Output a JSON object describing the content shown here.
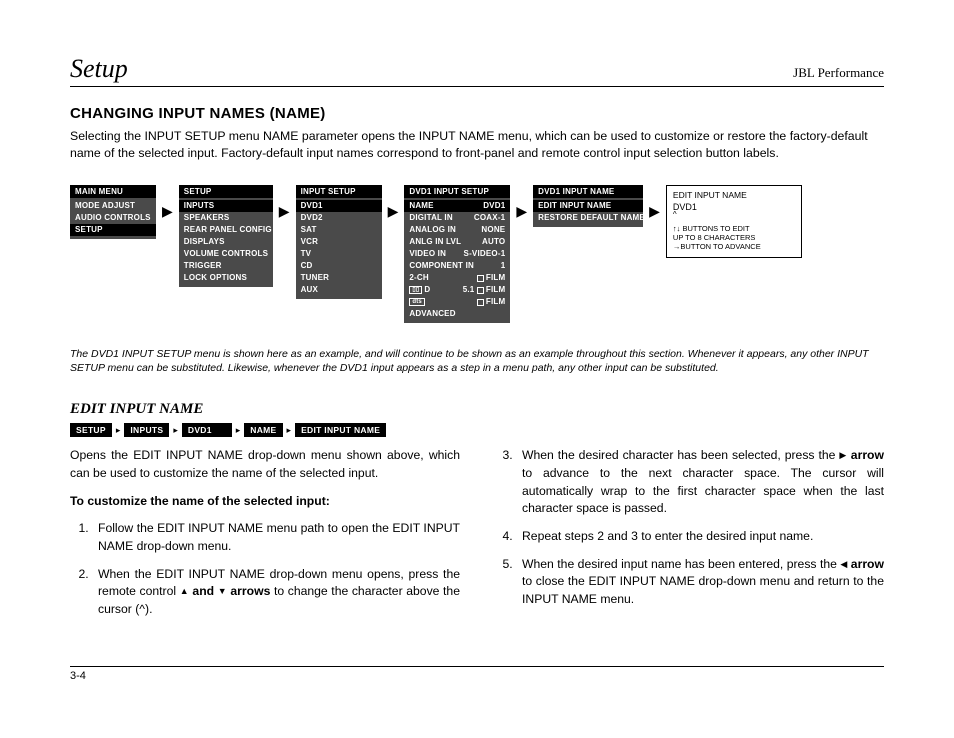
{
  "header": {
    "left": "Setup",
    "right": "JBL Performance"
  },
  "title": "CHANGING INPUT NAMES (NAME)",
  "intro": "Selecting the INPUT SETUP menu NAME parameter opens the INPUT NAME menu, which can be used to customize or restore the factory-default name of the selected input. Factory-default input names correspond to front-panel and remote control input selection button labels.",
  "menu1": {
    "title": "MAIN MENU",
    "items": [
      "MODE ADJUST",
      "AUDIO CONTROLS",
      "SETUP"
    ],
    "selected": 2
  },
  "menu2": {
    "title": "SETUP",
    "items": [
      "INPUTS",
      "SPEAKERS",
      "REAR PANEL CONFIG",
      "DISPLAYS",
      "VOLUME CONTROLS",
      "TRIGGER",
      "LOCK OPTIONS"
    ],
    "selected": 0
  },
  "menu3": {
    "title": "INPUT SETUP",
    "items": [
      "DVD1",
      "DVD2",
      "SAT",
      "VCR",
      "TV",
      "CD",
      "TUNER",
      "AUX"
    ],
    "selected": 0
  },
  "menu4": {
    "title": "DVD1 INPUT SETUP",
    "rows": [
      {
        "l": "NAME",
        "r": "DVD1",
        "sel": true
      },
      {
        "l": "DIGITAL IN",
        "r": "COAX-1"
      },
      {
        "l": "ANALOG IN",
        "r": "NONE"
      },
      {
        "l": "ANLG IN LVL",
        "r": "AUTO"
      },
      {
        "l": "VIDEO IN",
        "r": "S-VIDEO-1"
      },
      {
        "l": "COMPONENT IN",
        "r": "1"
      },
      {
        "l": "2-CH",
        "r": "□ FILM",
        "icon": "dd"
      },
      {
        "l": "□□ D",
        "r": "5.1 □ FILM",
        "icon": "dd"
      },
      {
        "l": "dts",
        "r": "□ FILM",
        "icon": "dts"
      },
      {
        "l": "ADVANCED",
        "r": ""
      }
    ]
  },
  "menu5": {
    "title": "DVD1 INPUT NAME",
    "items": [
      "EDIT INPUT NAME",
      "RESTORE DEFAULT NAME"
    ],
    "selected": 0
  },
  "editbox": {
    "title": "EDIT INPUT NAME",
    "value": "DVD1",
    "caret": "^",
    "help1": "↑↓ BUTTONS TO EDIT",
    "help2": "UP TO 8 CHARACTERS",
    "help3": "→BUTTON TO ADVANCE"
  },
  "caption": "The DVD1 INPUT SETUP menu is shown here as an example, and will continue to be shown as an example throughout this section. Whenever it appears, any other INPUT SETUP menu can be substituted. Likewise, whenever the DVD1 input appears as a step in a menu path, any other input can be substituted.",
  "subhead": "EDIT INPUT NAME",
  "crumbs": [
    "SETUP",
    "INPUTS",
    "DVD1",
    "NAME",
    "EDIT INPUT NAME"
  ],
  "col1": {
    "p1": "Opens the EDIT INPUT NAME drop-down menu shown above, which can be used to customize the name of the selected input.",
    "bold": "To customize the name of the selected input:",
    "s1": "Follow the EDIT INPUT NAME menu path to open the EDIT INPUT NAME drop-down menu.",
    "s2a": "When the EDIT INPUT NAME drop-down menu opens, press the remote control ",
    "s2b": " and ",
    "s2c": " arrows",
    "s2d": " to change the character above the cursor (^)."
  },
  "col2": {
    "s3a": "When the desired character has been selected, press the ",
    "s3b": " arrow",
    "s3c": " to advance to the next character space. The cursor will automatically wrap to the first character space when the last character space is passed.",
    "s4": "Repeat steps 2 and 3 to enter the desired input name.",
    "s5a": "When the desired input name has been entered, press the ",
    "s5b": " arrow",
    "s5c": " to close the EDIT INPUT NAME drop-down menu and return to the INPUT NAME menu."
  },
  "pagenum": "3-4"
}
